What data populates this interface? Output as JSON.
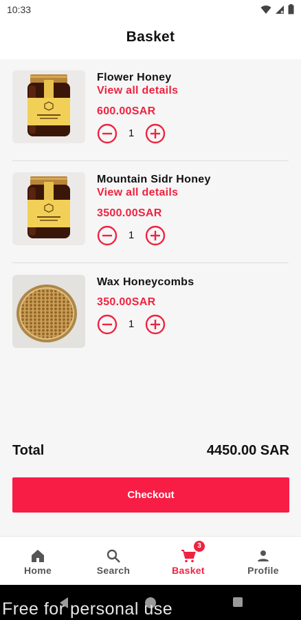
{
  "status_bar": {
    "time": "10:33"
  },
  "header": {
    "title": "Basket"
  },
  "items": [
    {
      "name": "Flower Honey",
      "link": "View all details",
      "price": "600.00SAR",
      "quantity": "1",
      "image_icon": "honey-jar-icon"
    },
    {
      "name": "Mountain Sidr Honey",
      "link": "View all details",
      "price": "3500.00SAR",
      "quantity": "1",
      "image_icon": "honey-jar-icon"
    },
    {
      "name": "Wax Honeycombs",
      "price": "350.00SAR",
      "quantity": "1",
      "image_icon": "honeycomb-icon"
    }
  ],
  "summary": {
    "total_label": "Total",
    "total_value": "4450.00 SAR"
  },
  "checkout": {
    "label": "Checkout"
  },
  "nav": {
    "items": [
      {
        "label": "Home",
        "icon": "home-icon"
      },
      {
        "label": "Search",
        "icon": "search-icon"
      },
      {
        "label": "Basket",
        "icon": "cart-icon",
        "badge": "3",
        "active": true
      },
      {
        "label": "Profile",
        "icon": "person-icon"
      }
    ]
  },
  "watermark": "Free for personal use",
  "colors": {
    "accent": "#f0223f",
    "button": "#f71d45",
    "background": "#f6f6f6"
  }
}
